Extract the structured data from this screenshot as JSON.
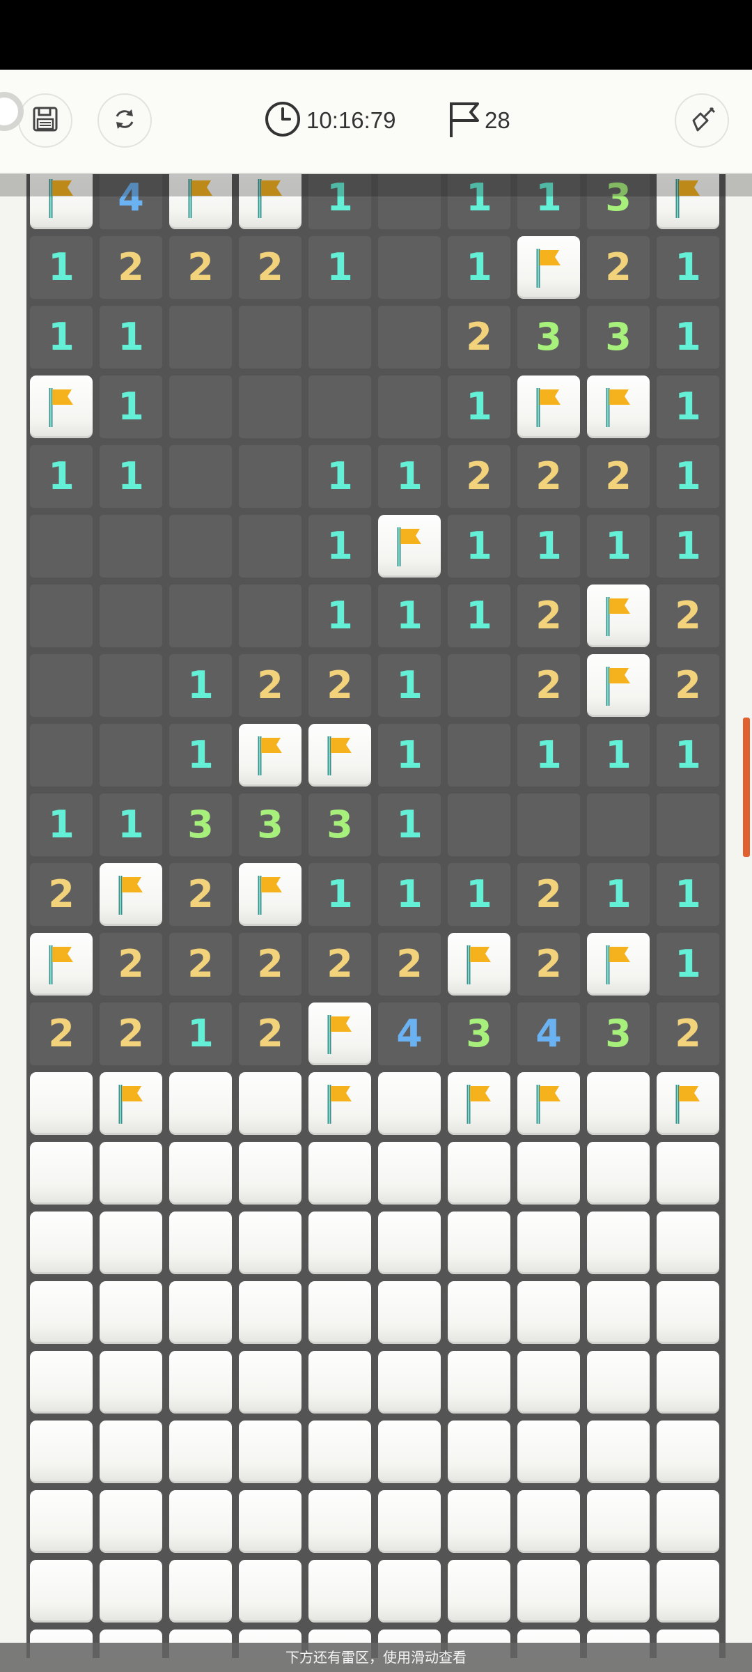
{
  "hud": {
    "timer": "10:16:79",
    "flags_remaining": "28"
  },
  "icons": {
    "save": "save-icon",
    "restart": "restart-icon",
    "clock": "clock-icon",
    "flag": "flag-icon",
    "shovel": "shovel-icon"
  },
  "colors": {
    "1": "#63f0d6",
    "2": "#f2d27a",
    "3": "#a7f07c",
    "4": "#6bb2f2",
    "flag": "#f6b21c"
  },
  "board": {
    "rows": [
      [
        "F",
        "4",
        "F",
        "F",
        "1",
        "",
        "1",
        "1",
        "3",
        "F"
      ],
      [
        "1",
        "2",
        "2",
        "2",
        "1",
        "",
        "1",
        "F",
        "2",
        "1"
      ],
      [
        "1",
        "1",
        "",
        "",
        "",
        "",
        "2",
        "3",
        "3",
        "1"
      ],
      [
        "F",
        "1",
        "",
        "",
        "",
        "",
        "1",
        "F",
        "F",
        "1"
      ],
      [
        "1",
        "1",
        "",
        "",
        "1",
        "1",
        "2",
        "2",
        "2",
        "1"
      ],
      [
        "",
        "",
        "",
        "",
        "1",
        "F",
        "1",
        "1",
        "1",
        "1"
      ],
      [
        "",
        "",
        "",
        "",
        "1",
        "1",
        "1",
        "2",
        "F",
        "2"
      ],
      [
        "",
        "",
        "1",
        "2",
        "2",
        "1",
        "",
        "2",
        "F",
        "2"
      ],
      [
        "",
        "",
        "1",
        "F",
        "F",
        "1",
        "",
        "1",
        "1",
        "1"
      ],
      [
        "1",
        "1",
        "3",
        "3",
        "3",
        "1",
        "",
        "",
        "",
        ""
      ],
      [
        "2",
        "F",
        "2",
        "F",
        "1",
        "1",
        "1",
        "2",
        "1",
        "1"
      ],
      [
        "F",
        "2",
        "2",
        "2",
        "2",
        "2",
        "F",
        "2",
        "F",
        "1"
      ],
      [
        "2",
        "2",
        "1",
        "2",
        "F",
        "4",
        "3",
        "4",
        "3",
        "2"
      ],
      [
        "C",
        "F",
        "C",
        "C",
        "F",
        "C",
        "F",
        "F",
        "C",
        "F"
      ],
      [
        "C",
        "C",
        "C",
        "C",
        "C",
        "C",
        "C",
        "C",
        "C",
        "C"
      ],
      [
        "C",
        "C",
        "C",
        "C",
        "C",
        "C",
        "C",
        "C",
        "C",
        "C"
      ],
      [
        "C",
        "C",
        "C",
        "C",
        "C",
        "C",
        "C",
        "C",
        "C",
        "C"
      ],
      [
        "C",
        "C",
        "C",
        "C",
        "C",
        "C",
        "C",
        "C",
        "C",
        "C"
      ],
      [
        "C",
        "C",
        "C",
        "C",
        "C",
        "C",
        "C",
        "C",
        "C",
        "C"
      ],
      [
        "C",
        "C",
        "C",
        "C",
        "C",
        "C",
        "C",
        "C",
        "C",
        "C"
      ],
      [
        "C",
        "C",
        "C",
        "C",
        "C",
        "C",
        "C",
        "C",
        "C",
        "C"
      ],
      [
        "C",
        "C",
        "C",
        "C",
        "C",
        "C",
        "C",
        "C",
        "C",
        "C"
      ]
    ]
  },
  "hint": "下方还有雷区，使用滑动查看"
}
